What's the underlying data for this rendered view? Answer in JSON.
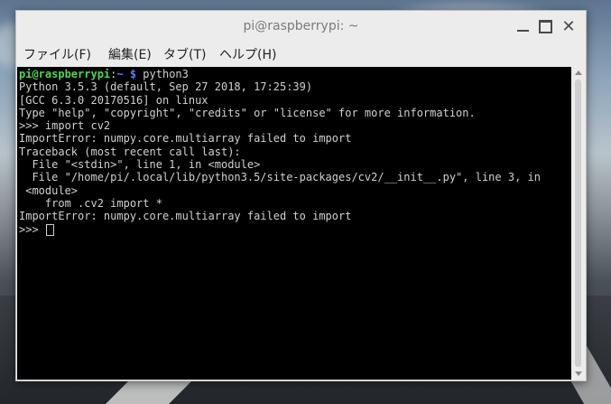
{
  "window": {
    "title": "pi@raspberrypi: ~"
  },
  "controls": {
    "minimize_icon": "minimize-icon",
    "maximize_icon": "maximize-icon",
    "close_icon": "close-icon",
    "close_glyph": "✕"
  },
  "menu": [
    {
      "label": "ファイル(F)"
    },
    {
      "label": "編集(E)"
    },
    {
      "label": "タブ(T)"
    },
    {
      "label": "ヘルプ(H)"
    }
  ],
  "terminal": {
    "prompt_user": "pi@raspberrypi",
    "prompt_colon": ":",
    "prompt_dir": "~ $",
    "command": " python3",
    "lines": [
      "Python 3.5.3 (default, Sep 27 2018, 17:25:39)",
      "[GCC 6.3.0 20170516] on linux",
      "Type \"help\", \"copyright\", \"credits\" or \"license\" for more information.",
      ">>> import cv2",
      "ImportError: numpy.core.multiarray failed to import",
      "Traceback (most recent call last):",
      "  File \"<stdin>\", line 1, in <module>",
      "  File \"/home/pi/.local/lib/python3.5/site-packages/cv2/__init__.py\", line 3, in",
      " <module>",
      "    from .cv2 import *",
      "ImportError: numpy.core.multiarray failed to import"
    ],
    "last_prompt": ">>> "
  },
  "colors": {
    "prompt_user": "#55d455",
    "prompt_dir": "#5c7cff",
    "terminal_bg": "#000000",
    "terminal_fg": "#d0d0d0"
  }
}
